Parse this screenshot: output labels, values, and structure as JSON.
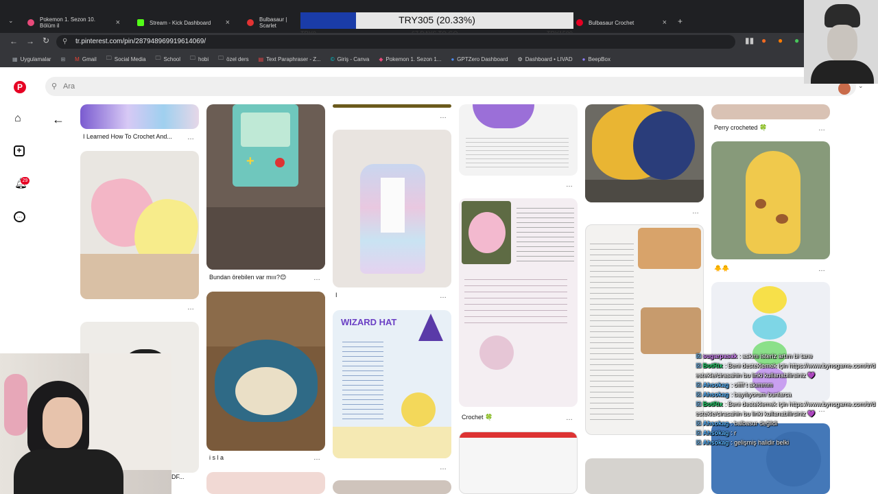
{
  "browser": {
    "tabs": [
      {
        "label": "Pokemon 1. Sezon 10. Bölüm il",
        "fav_color": "#e84a7a"
      },
      {
        "label": "Stream - Kick Dashboard",
        "fav_color": "#53fc18"
      },
      {
        "label": "Bulbasaur | Scarlet",
        "fav_color": "#e33333"
      },
      {
        "label": "Bulbasaur Crochet",
        "fav_color": "#e60023"
      }
    ],
    "new_tab": "+",
    "url": "tr.pinterest.com/pin/287948969919614069/",
    "bookmarks": [
      "Uygulamalar",
      "Gmail",
      "Social Media",
      "School",
      "hobi",
      "özel ders",
      "Text Paraphraser - Z...",
      "Giriş - Canva",
      "Pokemon 1. Sezon 1...",
      "GPTZero Dashboard",
      "Dashboard • LIVAD",
      "BeepBox"
    ]
  },
  "goal": {
    "text": "TRY305 (20.33%)",
    "fraction": 0.2033,
    "left_label": "TRY0",
    "center_label": "67 DAYS TO GO",
    "right_label": "TRY1500"
  },
  "pinterest": {
    "search_placeholder": "Ara",
    "notification_count": "29",
    "brand_color": "#e60023",
    "captions": {
      "col1_top": "I Learned How To Crochet And...",
      "col2_mid": "Bundan örebilen var mııı?😊",
      "col2_bottom": "i s l a",
      "col3_mid": "I",
      "col4_mid": "Crochet 🍀",
      "col5_top": "Perry crocheted 🍀",
      "col5_mid": "🐥🐥",
      "col1_bottom": "DF..."
    },
    "pin_texts": {
      "wizard_hat": "WIZARD HAT"
    }
  },
  "chat": [
    {
      "user": "sugarpasak",
      "msg": "askını isteriz artım bi tane",
      "color": "#d88aff"
    },
    {
      "user": "BotRix",
      "msg": "Beni desteklemek için https://www.bynogame.com/tr/destekle/cirasahin bu linki kullanabilirsiniz 💜",
      "color": "#22d16b"
    },
    {
      "user": "Ahsokag",
      "msg": "offff t akımmm",
      "color": "#5bb7ff"
    },
    {
      "user": "Ahsokag",
      "msg": "bayılıyorum bunlarca",
      "color": "#5bb7ff"
    },
    {
      "user": "BotRix",
      "msg": "Beni desteklemek için https://www.bynogame.com/tr/destekle/cirasahin bu linki kullanabilirsiniz 💜",
      "color": "#22d16b"
    },
    {
      "user": "Ahsokag",
      "msg": "balbasur değildi",
      "color": "#5bb7ff"
    },
    {
      "user": "Ahsokag",
      "msg": "r",
      "color": "#5bb7ff"
    },
    {
      "user": "Ahsokag",
      "msg": "gelişmiş halidir belki",
      "color": "#5bb7ff"
    }
  ]
}
